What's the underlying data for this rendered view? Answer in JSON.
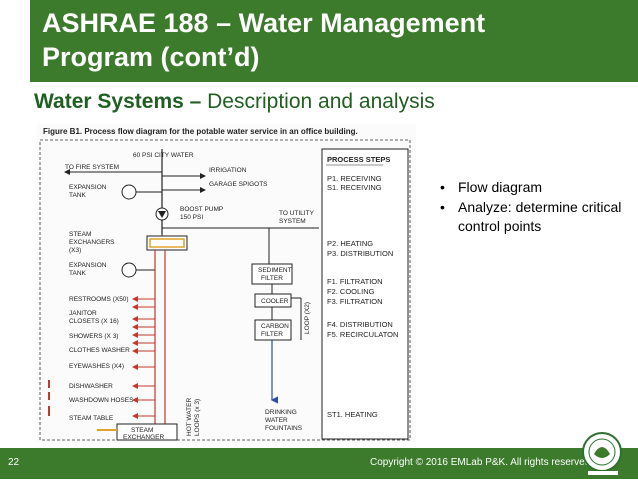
{
  "slide": {
    "title_line1": "ASHRAE 188 – Water Management",
    "title_line2": "Program (cont’d)",
    "subtitle_bold": "Water Systems – ",
    "subtitle_rest": "Description and analysis",
    "page_number": "22",
    "copyright": "Copyright © 2016 EMLab P&K. All rights reserved.",
    "accent_color": "#3c7a2c"
  },
  "figure": {
    "caption": "Figure B1. Process flow diagram for the potable water service in an office building.",
    "left_labels": {
      "city_water": "60 PSI CITY WATER",
      "fire": "TO FIRE SYSTEM",
      "irrigation": "IRRIGATION",
      "garage": "GARAGE SPIGOTS",
      "expansion1_a": "EXPANSION",
      "expansion1_b": "TANK",
      "boost_a": "BOOST PUMP",
      "boost_b": "150 PSI",
      "utility_a": "TO UTILITY",
      "utility_b": "SYSTEM",
      "steam_a": "STEAM",
      "steam_b": "EXCHANGERS",
      "steam_c": "(X3)",
      "expansion2_a": "EXPANSION",
      "expansion2_b": "TANK",
      "restrooms": "RESTROOMS (X50)",
      "janitor_a": "JANITOR",
      "janitor_b": "CLOSETS (X 16)",
      "showers": "SHOWERS (X 3)",
      "clothes": "CLOTHES WASHER",
      "eyewash": "EYEWASHES (X4)",
      "dishwasher": "DISHWASHER",
      "washdown": "WASHDOWN HOSES",
      "steam_table": "STEAM TABLE",
      "steam_ex2_a": "STEAM",
      "steam_ex2_b": "EXCHANGER",
      "sediment_a": "SEDIMENT",
      "sediment_b": "FILTER",
      "cooler": "COOLER",
      "carbon_a": "CARBON",
      "carbon_b": "FILTER",
      "loop": "LOOP (X2)",
      "hot_water_a": "HOT WATER",
      "hot_water_b": "LOOPS (x 3)",
      "drinking_a": "DRINKING",
      "drinking_b": "WATER",
      "drinking_c": "FOUNTAINS"
    },
    "steps_header": "PROCESS STEPS",
    "steps": [
      "P1. RECEIVING",
      "S1. RECEIVING",
      "P2. HEATING",
      "P3. DISTRIBUTION",
      "F1. FILTRATION",
      "F2. COOLING",
      "F3. FILTRATION",
      "F4. DISTRIBUTION",
      "F5. RECIRCULATON",
      "ST1. HEATING"
    ]
  },
  "bullets": [
    {
      "text": "Flow diagram"
    },
    {
      "text": "Analyze: determine critical control points"
    }
  ]
}
